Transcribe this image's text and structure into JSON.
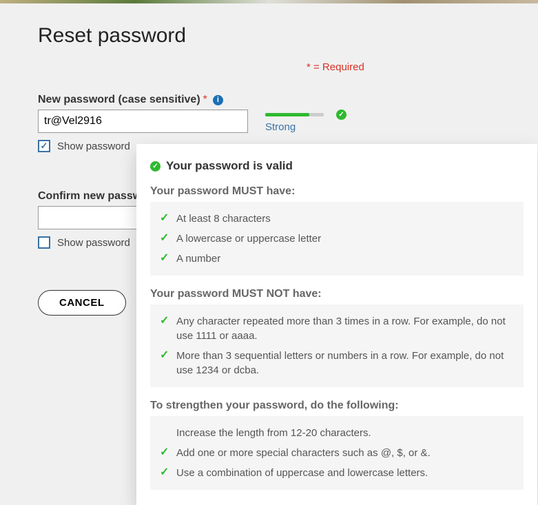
{
  "page": {
    "title": "Reset password",
    "required_note": "* = Required"
  },
  "new_password": {
    "label": "New password (case sensitive)",
    "value": "tr@Vel2916",
    "show_label": "Show password",
    "show_checked": true
  },
  "strength": {
    "label": "Strong"
  },
  "confirm_password": {
    "label": "Confirm new password (case sensitive)",
    "value": "",
    "show_label": "Show password",
    "show_checked": false
  },
  "buttons": {
    "cancel": "CANCEL"
  },
  "rules": {
    "valid_heading": "Your password is valid",
    "must_heading": "Your password MUST have:",
    "must": [
      "At least 8 characters",
      "A lowercase or uppercase letter",
      "A number"
    ],
    "mustnot_heading": "Your password MUST NOT have:",
    "mustnot": [
      "Any character repeated more than 3 times in a row. For example, do not use 1111 or aaaa.",
      "More than 3 sequential letters or numbers in a row. For example, do not use 1234 or dcba."
    ],
    "strengthen_heading": "To strengthen your password, do the following:",
    "strengthen": [
      {
        "text": "Increase the length from 12-20 characters.",
        "done": false
      },
      {
        "text": "Add one or more special characters such as @, $, or &.",
        "done": true
      },
      {
        "text": "Use a combination of uppercase and lowercase letters.",
        "done": true
      }
    ]
  }
}
